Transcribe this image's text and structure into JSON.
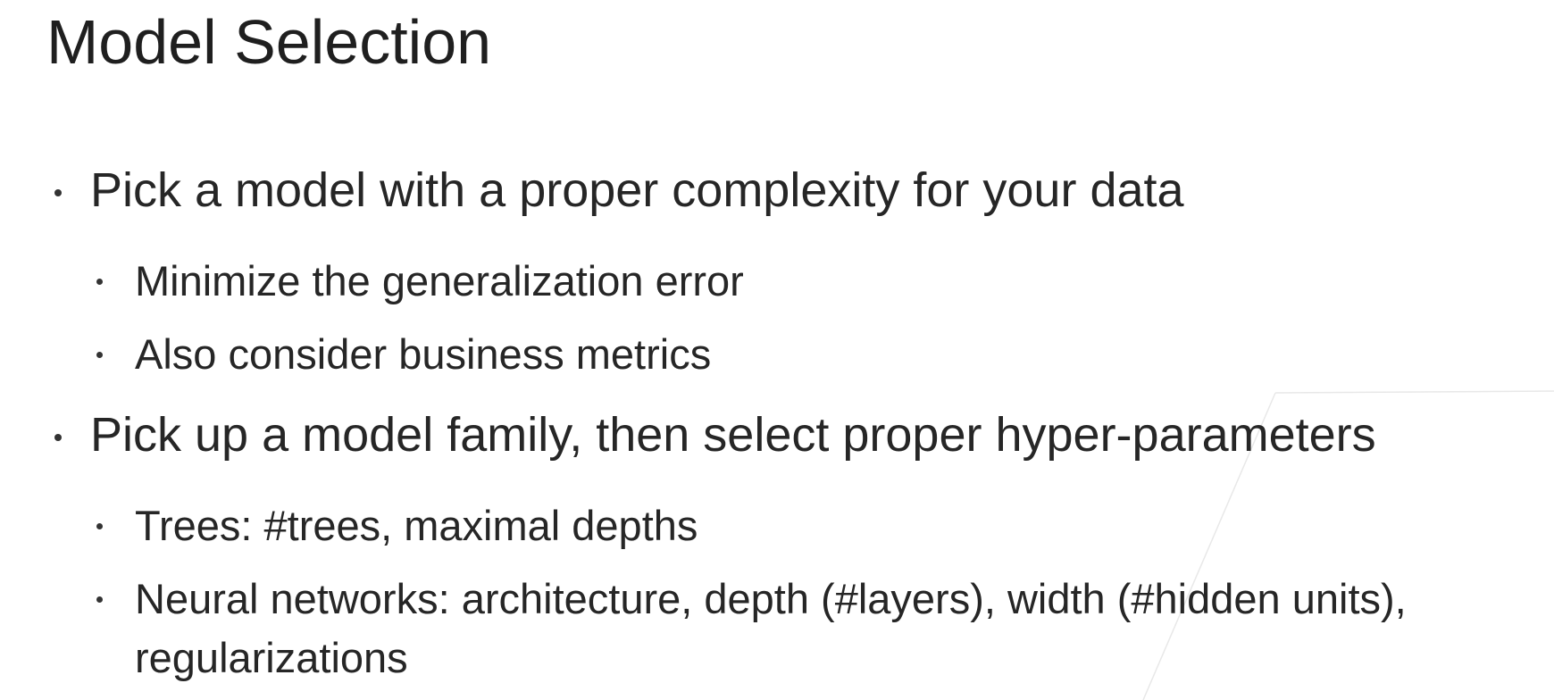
{
  "slide": {
    "title": "Model Selection",
    "bullets": [
      {
        "text": "Pick a model with a proper complexity for your data",
        "sub": [
          "Minimize the generalization error",
          "Also consider business metrics"
        ]
      },
      {
        "text": "Pick up a model family, then select proper hyper-parameters",
        "sub": [
          "Trees: #trees, maximal depths",
          "Neural networks: architecture, depth (#layers), width (#hidden units), regularizations"
        ]
      }
    ]
  }
}
